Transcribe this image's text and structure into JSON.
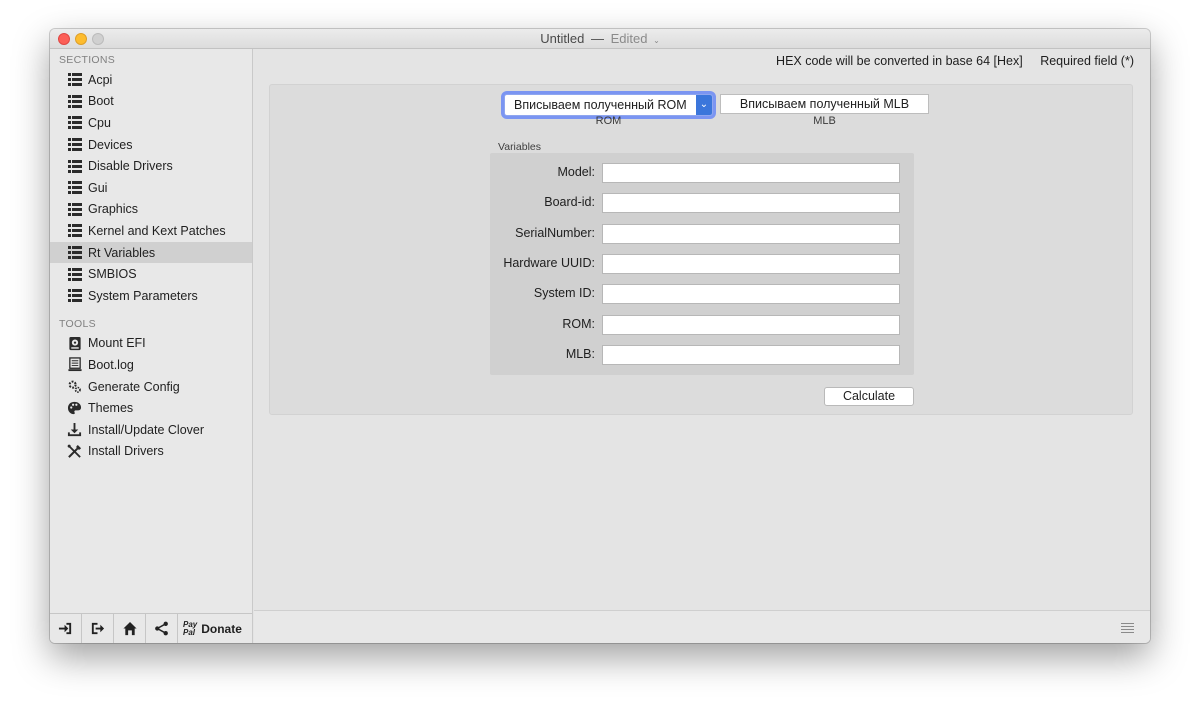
{
  "window": {
    "title": "Untitled",
    "title_separator": "—",
    "title_status": "Edited"
  },
  "sidebar": {
    "sections_heading": "SECTIONS",
    "sections": [
      {
        "label": "Acpi",
        "icon": "list-icon"
      },
      {
        "label": "Boot",
        "icon": "list-icon"
      },
      {
        "label": "Cpu",
        "icon": "list-icon"
      },
      {
        "label": "Devices",
        "icon": "list-icon"
      },
      {
        "label": "Disable Drivers",
        "icon": "list-icon"
      },
      {
        "label": "Gui",
        "icon": "list-icon"
      },
      {
        "label": "Graphics",
        "icon": "list-icon"
      },
      {
        "label": "Kernel and Kext Patches",
        "icon": "list-icon"
      },
      {
        "label": "Rt Variables",
        "icon": "list-icon",
        "selected": true
      },
      {
        "label": "SMBIOS",
        "icon": "list-icon"
      },
      {
        "label": "System Parameters",
        "icon": "list-icon"
      }
    ],
    "tools_heading": "TOOLS",
    "tools": [
      {
        "label": "Mount EFI",
        "icon": "disk-icon"
      },
      {
        "label": "Boot.log",
        "icon": "log-icon"
      },
      {
        "label": "Generate Config",
        "icon": "gears-icon"
      },
      {
        "label": "Themes",
        "icon": "palette-icon"
      },
      {
        "label": "Install/Update Clover",
        "icon": "download-icon"
      },
      {
        "label": "Install Drivers",
        "icon": "tools-icon"
      }
    ],
    "footer": {
      "donate_label": "Donate",
      "paypal_top": "Pay",
      "paypal_bottom": "Pal"
    }
  },
  "main": {
    "hex_note": "HEX code will be converted in base 64 [Hex]",
    "required_note": "Required field (*)",
    "rom_combo_value": "Вписываем полученный ROM",
    "rom_label": "ROM",
    "mlb_field_value": "Вписываем полученный MLB",
    "mlb_label": "MLB",
    "variables_title": "Variables",
    "variables": [
      {
        "label": "Model:",
        "value": ""
      },
      {
        "label": "Board-id:",
        "value": ""
      },
      {
        "label": "SerialNumber:",
        "value": ""
      },
      {
        "label": "Hardware UUID:",
        "value": ""
      },
      {
        "label": "System ID:",
        "value": ""
      },
      {
        "label": "ROM:",
        "value": ""
      },
      {
        "label": "MLB:",
        "value": ""
      }
    ],
    "calculate_label": "Calculate"
  },
  "colors": {
    "selection_bg": "#d0d0d0",
    "focus_ring": "#7b95f2",
    "combo_arrow": "#3b76db"
  }
}
